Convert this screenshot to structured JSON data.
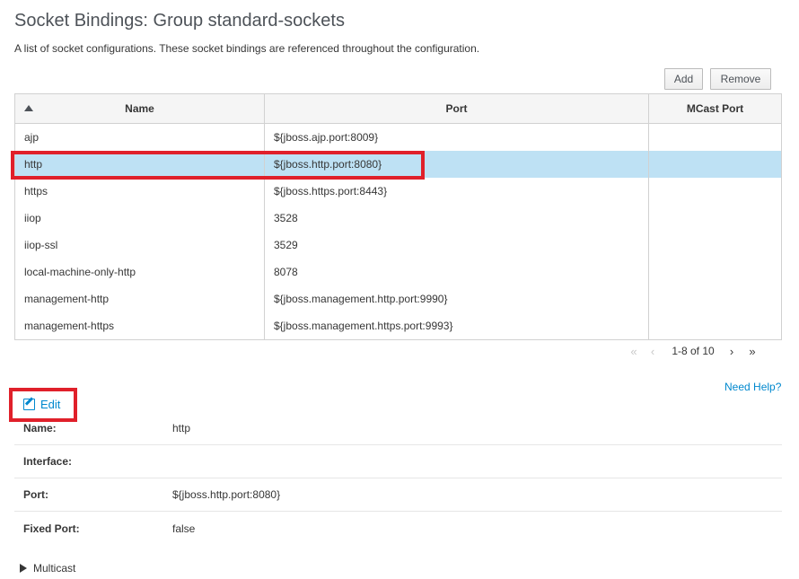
{
  "page": {
    "title": "Socket Bindings: Group standard-sockets",
    "description": "A list of socket configurations. These socket bindings are referenced throughout the configuration."
  },
  "toolbar": {
    "add_label": "Add",
    "remove_label": "Remove"
  },
  "table": {
    "sorted_column": "Name",
    "sort_direction": "ascending",
    "columns": [
      "Name",
      "Port",
      "MCast Port"
    ],
    "rows": [
      {
        "name": "ajp",
        "port": "${jboss.ajp.port:8009}",
        "mcast": ""
      },
      {
        "name": "http",
        "port": "${jboss.http.port:8080}",
        "mcast": "",
        "selected": true
      },
      {
        "name": "https",
        "port": "${jboss.https.port:8443}",
        "mcast": ""
      },
      {
        "name": "iiop",
        "port": "3528",
        "mcast": ""
      },
      {
        "name": "iiop-ssl",
        "port": "3529",
        "mcast": ""
      },
      {
        "name": "local-machine-only-http",
        "port": "8078",
        "mcast": ""
      },
      {
        "name": "management-http",
        "port": "${jboss.management.http.port:9990}",
        "mcast": ""
      },
      {
        "name": "management-https",
        "port": "${jboss.management.https.port:9993}",
        "mcast": ""
      }
    ]
  },
  "pager": {
    "first": "«",
    "prev": "‹",
    "label": "1-8 of 10",
    "next": "›",
    "last": "»"
  },
  "help_link": "Need Help?",
  "edit_label": "Edit",
  "details": [
    {
      "label": "Name:",
      "value": "http"
    },
    {
      "label": "Interface:",
      "value": ""
    },
    {
      "label": "Port:",
      "value": "${jboss.http.port:8080}"
    },
    {
      "label": "Fixed Port:",
      "value": "false"
    }
  ],
  "multicast_label": "Multicast",
  "colors": {
    "accent": "#0088ce",
    "selected_row": "#bee1f4",
    "highlight": "#e0202a"
  }
}
